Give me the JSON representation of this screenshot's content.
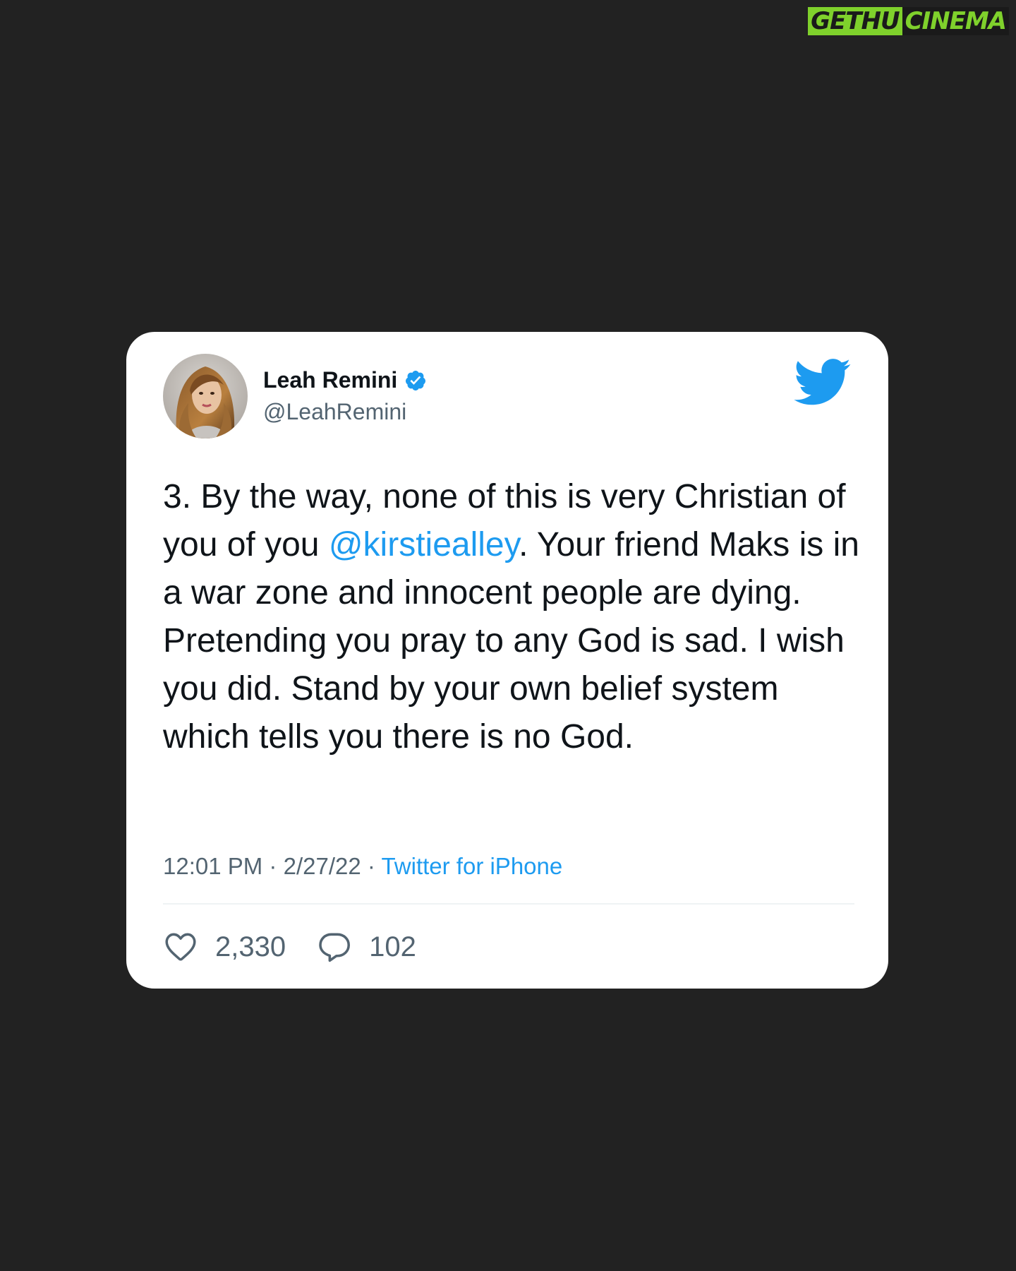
{
  "watermark": {
    "part1": "GETHU",
    "part2": "CINEMA"
  },
  "tweet": {
    "display_name": "Leah Remini",
    "handle": "@LeahRemini",
    "text_before_mention": "3. By the way, none of this is very Christian of you of you ",
    "mention": "@kirstiealley",
    "text_after_mention": ". Your friend Maks is in a war zone and innocent people are dying. Pretending you pray to any God is sad. I wish you did.  Stand by your own belief system which tells you there is no God.",
    "time": "12:01 PM",
    "separator": "·",
    "date": "2/27/22",
    "source": "Twitter for iPhone",
    "likes": "2,330",
    "replies": "102"
  },
  "icons": {
    "verified": "verified-badge-icon",
    "brand": "twitter-bird-icon",
    "like": "heart-icon",
    "reply": "speech-bubble-icon"
  },
  "colors": {
    "background": "#222222",
    "card": "#ffffff",
    "accent": "#1d9bf0",
    "text": "#0f1419",
    "secondary": "#536471",
    "watermark_green": "#7fd12c"
  }
}
